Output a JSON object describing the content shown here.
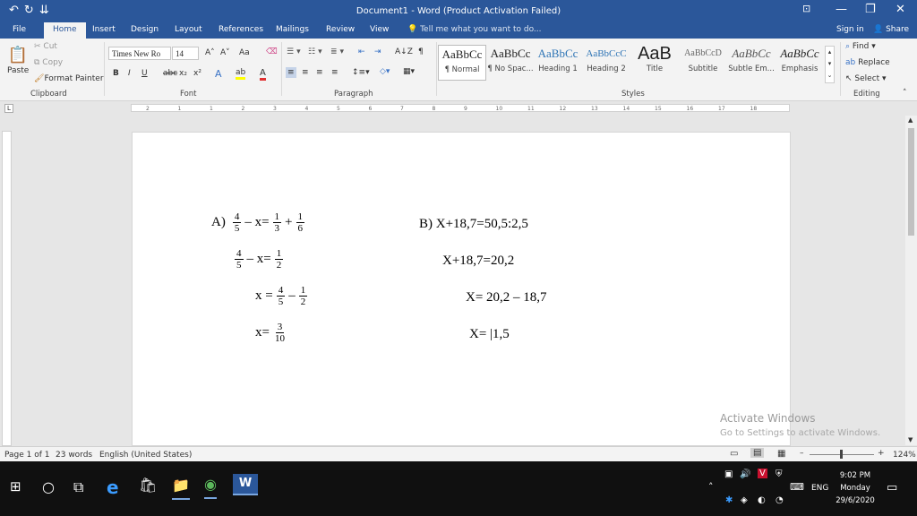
{
  "window": {
    "title": "Document1 - Word (Product Activation Failed)",
    "quick_access": [
      "↶",
      "↻",
      "⇊"
    ],
    "controls": [
      "⊡",
      "—",
      "❐",
      "✕"
    ]
  },
  "tabs": [
    "File",
    "Home",
    "Insert",
    "Design",
    "Layout",
    "References",
    "Mailings",
    "Review",
    "View"
  ],
  "tell_me": "Tell me what you want to do...",
  "signin": "Sign in",
  "share": "Share",
  "clipboard": {
    "paste": "Paste",
    "cut": "Cut",
    "copy": "Copy",
    "format_painter": "Format Painter",
    "label": "Clipboard"
  },
  "font": {
    "name": "Times New Ro",
    "size": "14",
    "label": "Font",
    "bold": "B",
    "italic": "I",
    "underline": "U",
    "strike": "abc",
    "sub": "x₂",
    "sup": "x²",
    "grow": "A˄",
    "shrink": "A˅",
    "case": "Aa",
    "effects": "A",
    "highlight": "ab",
    "color": "A"
  },
  "paragraph": {
    "label": "Paragraph",
    "sort": "A↓Z",
    "pilcrow": "¶"
  },
  "styles": {
    "label": "Styles",
    "items": [
      {
        "preview": "AaBbCc",
        "name": "¶ Normal"
      },
      {
        "preview": "AaBbCc",
        "name": "¶ No Spac..."
      },
      {
        "preview": "AaBbCc",
        "name": "Heading 1"
      },
      {
        "preview": "AaBbCcC",
        "name": "Heading 2"
      },
      {
        "preview": "AaB",
        "name": "Title"
      },
      {
        "preview": "AaBbCcD",
        "name": "Subtitle"
      },
      {
        "preview": "AaBbCc",
        "name": "Subtle Em..."
      },
      {
        "preview": "AaBbCc",
        "name": "Emphasis"
      }
    ]
  },
  "editing": {
    "find": "Find",
    "replace": "Replace",
    "select": "Select",
    "label": "Editing"
  },
  "ruler_marks": [
    "2",
    "1",
    "1",
    "2",
    "3",
    "4",
    "5",
    "6",
    "7",
    "8",
    "9",
    "10",
    "11",
    "12",
    "13",
    "14",
    "15",
    "16",
    "17",
    "18"
  ],
  "doc": {
    "a_label": "A)",
    "a1": {
      "f1n": "4",
      "f1d": "5",
      "mid": "– x=",
      "f2n": "1",
      "f2d": "3",
      "plus": "+",
      "f3n": "1",
      "f3d": "6"
    },
    "a2": {
      "f1n": "4",
      "f1d": "5",
      "mid": "– x=",
      "f2n": "1",
      "f2d": "2"
    },
    "a3": {
      "pre": "x =",
      "f1n": "4",
      "f1d": "5",
      "mid": "–",
      "f2n": "1",
      "f2d": "2"
    },
    "a4": {
      "pre": "x=",
      "f1n": "3",
      "f1d": "10"
    },
    "b1": "B) X+18,7=50,5:2,5",
    "b2": "X+18,7=20,2",
    "b3": "X= 20,2 –  18,7",
    "b4": "X= |1,5"
  },
  "watermark": {
    "line1": "Activate Windows",
    "line2": "Go to Settings to activate Windows."
  },
  "status": {
    "page": "Page 1 of 1",
    "words": "23 words",
    "lang": "English (United States)",
    "zoom": "124%"
  },
  "taskbar": {
    "lang": "ENG",
    "time": "9:02 PM",
    "day": "Monday",
    "date": "29/6/2020"
  }
}
